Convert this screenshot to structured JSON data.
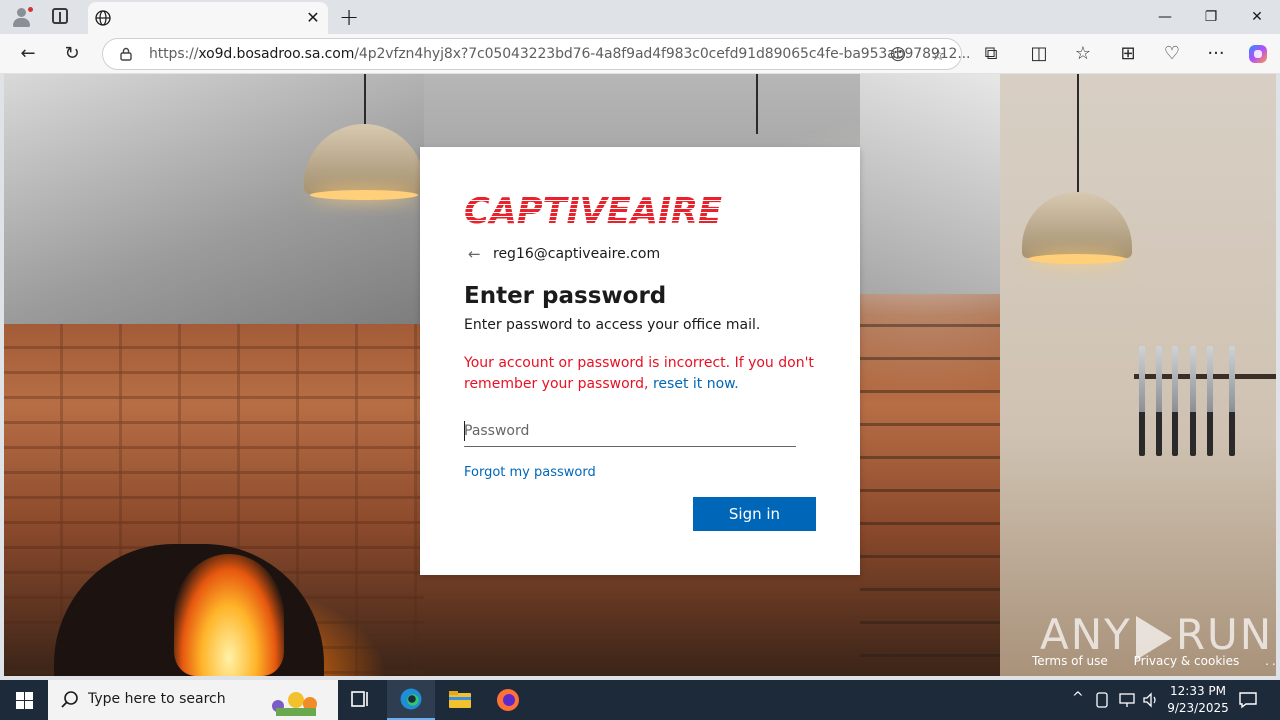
{
  "browser": {
    "tab_title": "",
    "new_tab_symbol": "+",
    "close_tab_symbol": "✕",
    "window_controls": {
      "minimize": "—",
      "restore": "❐",
      "close": "✕"
    },
    "address": {
      "scheme": "https://",
      "host": "xo9d.bosadroo.sa.com",
      "path": "/4p2vfzn4hyj8x?7c05043223bd76-4a8f9ad4f983c0cefd91d89065c4fe-ba953ab978912..."
    },
    "icons": {
      "back": "←",
      "reload": "↻",
      "read_aloud": "☺",
      "favorite": "☆",
      "extensions": "⧉",
      "split_screen": "◫",
      "favorites": "☆",
      "collections": "⊞",
      "performance": "♡",
      "menu": "···"
    }
  },
  "login": {
    "logo_text": "CAPTIVEAIRE",
    "logo_color": "#e8212b",
    "back_arrow": "←",
    "email": "reg16@captiveaire.com",
    "heading": "Enter password",
    "subtext": "Enter password to access your office mail.",
    "error_text": "Your account or password is incorrect. If you don't remember your password,",
    "error_link": "reset it now.",
    "password_placeholder": "Password",
    "password_value": "",
    "forgot_link": "Forgot my password",
    "signin_label": "Sign in",
    "accent_color": "#0067b8",
    "error_color": "#e81123"
  },
  "footer": {
    "terms": "Terms of use",
    "privacy": "Privacy & cookies",
    "more": "..."
  },
  "watermark": {
    "left": "ANY",
    "right": "RUN"
  },
  "taskbar": {
    "search_placeholder": "Type here to search",
    "time": "12:33 PM",
    "date": "9/23/2025",
    "tray_chevron": "^"
  }
}
